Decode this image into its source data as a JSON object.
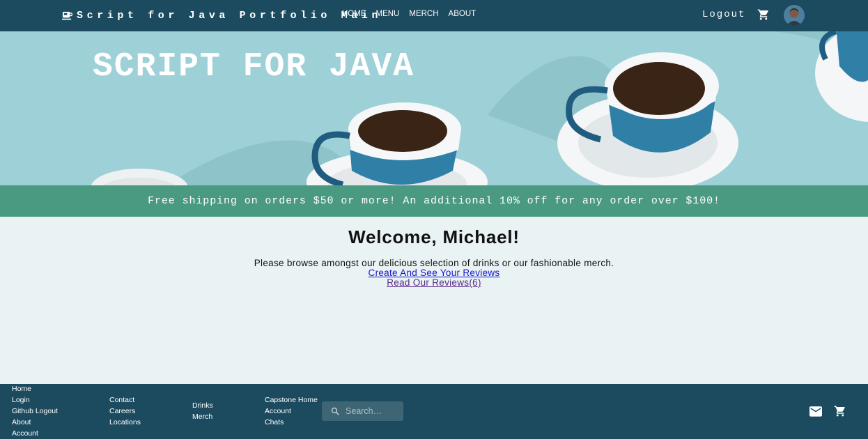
{
  "nav": {
    "brand": "Script for Java Portfolio Main",
    "links": [
      "HOME",
      "MENU",
      "MERCH",
      "ABOUT"
    ],
    "logout": "Logout"
  },
  "hero": {
    "title": "SCRIPT FOR JAVA"
  },
  "promo": {
    "text": "Free shipping on orders $50 or more! An additional 10% off for any order over $100!"
  },
  "main": {
    "welcome": "Welcome, Michael!",
    "intro": "Please browse amongst our delicious selection of drinks or our fashionable merch.",
    "create_reviews": "Create And See Your Reviews",
    "read_reviews": "Read Our Reviews(6)"
  },
  "footer": {
    "col1": [
      "Home",
      "Login",
      "Github Logout",
      "About",
      "Account"
    ],
    "col2": [
      "Contact",
      "Careers",
      "Locations"
    ],
    "col3": [
      "Drinks",
      "Merch"
    ],
    "col4": [
      "Capstone Home",
      "Account",
      "Chats"
    ],
    "search_placeholder": "Search…"
  },
  "icons": {
    "brand": "coffee-cup-icon",
    "nav_cart": "cart-icon",
    "search": "search-icon",
    "mail": "mail-icon",
    "footer_cart": "cart-icon"
  },
  "colors": {
    "nav_bg": "#1c4a5e",
    "hero_bg": "#9dd1d7",
    "promo_bg": "#4a9a82",
    "page_bg": "#e9f3f4",
    "footer_bg": "#1c4a5e"
  }
}
